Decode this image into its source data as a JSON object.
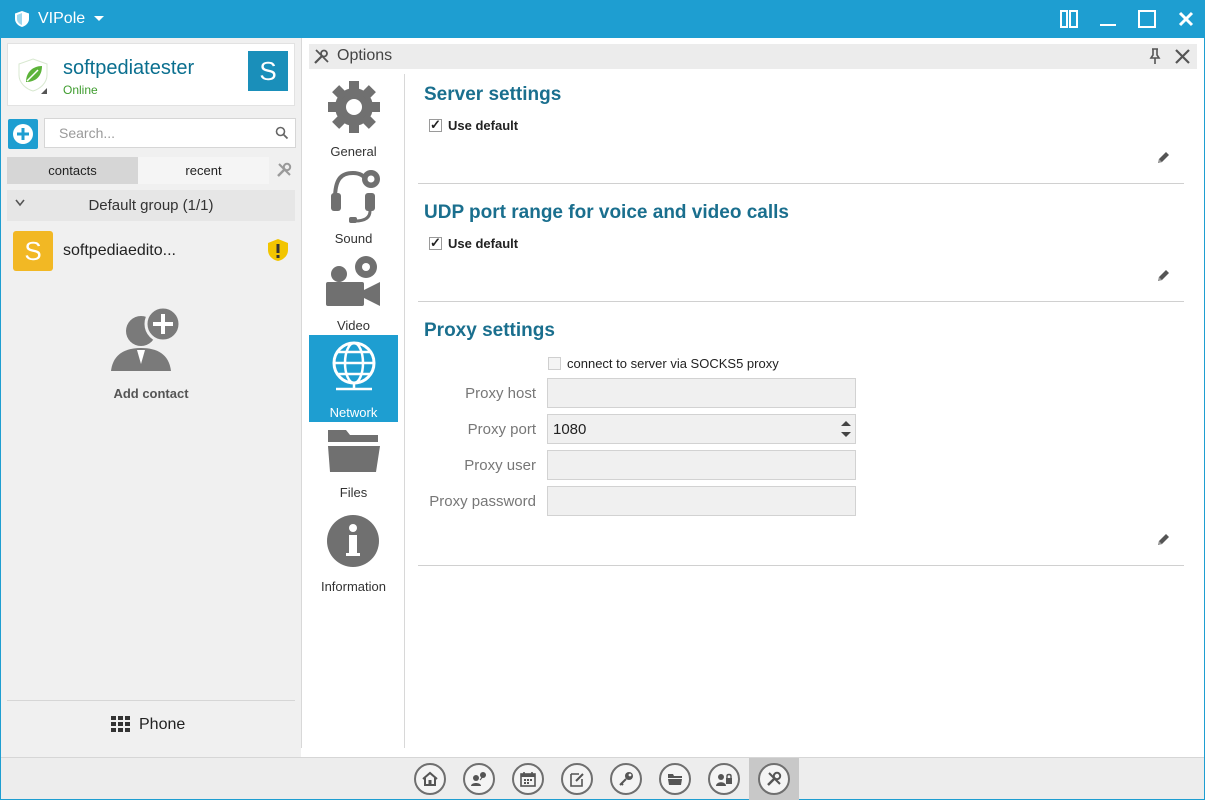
{
  "app": {
    "title": "VIPole"
  },
  "profile": {
    "username": "softpediatester",
    "status": "Online",
    "avatar_letter": "S"
  },
  "search": {
    "placeholder": "Search..."
  },
  "tabs": {
    "contacts": "contacts",
    "recent": "recent"
  },
  "group": {
    "label": "Default group (1/1)"
  },
  "contact": {
    "name": "softpediaedito...",
    "avatar_letter": "S"
  },
  "add_contact": {
    "label": "Add contact"
  },
  "phone": {
    "label": "Phone"
  },
  "options": {
    "title": "Options"
  },
  "categories": [
    {
      "label": "General",
      "icon": "gear-icon"
    },
    {
      "label": "Sound",
      "icon": "headset-icon"
    },
    {
      "label": "Video",
      "icon": "video-camera-icon"
    },
    {
      "label": "Network",
      "icon": "globe-icon"
    },
    {
      "label": "Files",
      "icon": "folder-icon"
    },
    {
      "label": "Information",
      "icon": "info-icon"
    }
  ],
  "server_settings": {
    "title": "Server settings",
    "use_default": "Use default",
    "checked": true
  },
  "udp_settings": {
    "title": "UDP port range for voice and video calls",
    "use_default": "Use default",
    "checked": true
  },
  "proxy_settings": {
    "title": "Proxy settings",
    "socks_label": "connect to server via SOCKS5 proxy",
    "socks_checked": false,
    "host_label": "Proxy host",
    "host_value": "",
    "port_label": "Proxy port",
    "port_value": "1080",
    "user_label": "Proxy user",
    "user_value": "",
    "password_label": "Proxy password",
    "password_value": ""
  },
  "toolbar_icons": [
    "home-icon",
    "contacts-network-icon",
    "calendar-icon",
    "notes-icon",
    "key-icon",
    "folder-icon",
    "secure-contacts-icon",
    "tools-icon"
  ],
  "colors": {
    "accent": "#1e9ed1",
    "title_text": "#1a6f8e",
    "contact_avatar": "#f2b824",
    "online": "#3f9c2f"
  }
}
